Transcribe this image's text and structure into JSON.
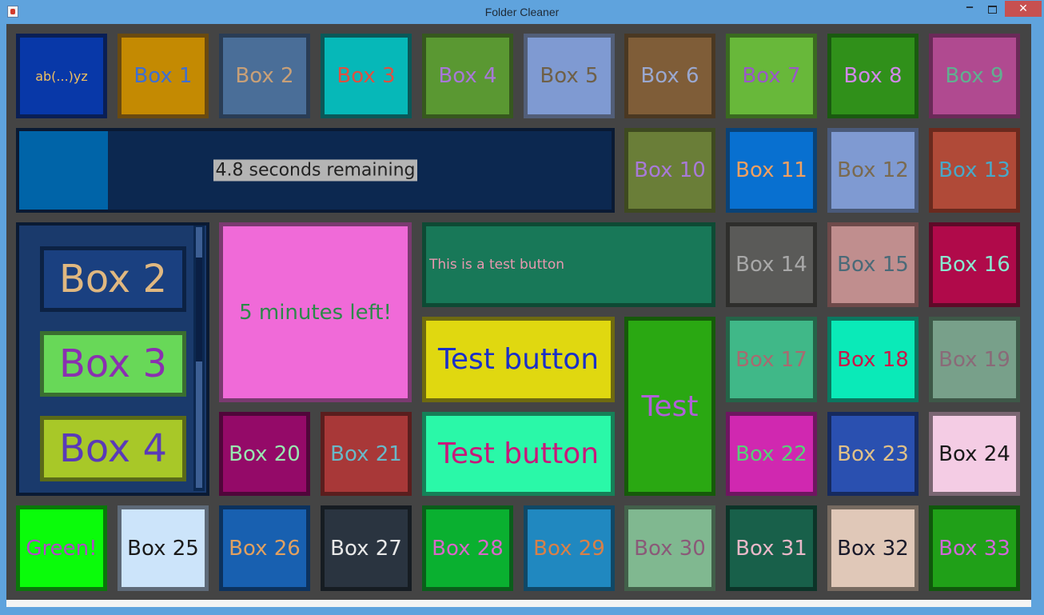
{
  "window": {
    "title": "Folder Cleaner",
    "controls": {
      "minimize": "‒",
      "maximize": "",
      "close": "✕"
    }
  },
  "top_row": {
    "search": "ab(...)yz",
    "boxes": [
      "Box 1",
      "Box 2",
      "Box 3",
      "Box 4",
      "Box 5",
      "Box 6",
      "Box 7",
      "Box 8",
      "Box 9"
    ]
  },
  "progress": {
    "label": "4.8 seconds remaining",
    "fill_fraction": 0.15
  },
  "row2_boxes": [
    "Box 10",
    "Box 11",
    "Box 12",
    "Box 13"
  ],
  "scroll_panel": {
    "items": [
      "Box 2",
      "Box 3",
      "Box 4"
    ]
  },
  "timer_box": "5 minutes left!",
  "buttons": {
    "test_button_wide": "This is a test button",
    "test_button_yellow": "Test button",
    "test_button_mint": "Test button",
    "test_tall": "Test"
  },
  "row3_boxes": [
    "Box 14",
    "Box 15",
    "Box 16"
  ],
  "row4_boxes": [
    "Box 17",
    "Box 18",
    "Box 19"
  ],
  "row5_boxes": [
    "Box 20",
    "Box 21",
    "Box 22",
    "Box 23",
    "Box 24"
  ],
  "bottom_row": {
    "green": "Green!",
    "boxes": [
      "Box 25",
      "Box 26",
      "Box 27",
      "Box 28",
      "Box 29",
      "Box 30",
      "Box 31",
      "Box 32",
      "Box 33"
    ]
  },
  "colors": {
    "window_background": "#444444",
    "titlebar": "#5fa3dd",
    "close_button": "#c75050",
    "progress_fill": "#0064a8",
    "progress_track": "#0c2850"
  },
  "icons": [
    "java-app-icon",
    "minimize-icon",
    "maximize-icon",
    "close-icon"
  ]
}
